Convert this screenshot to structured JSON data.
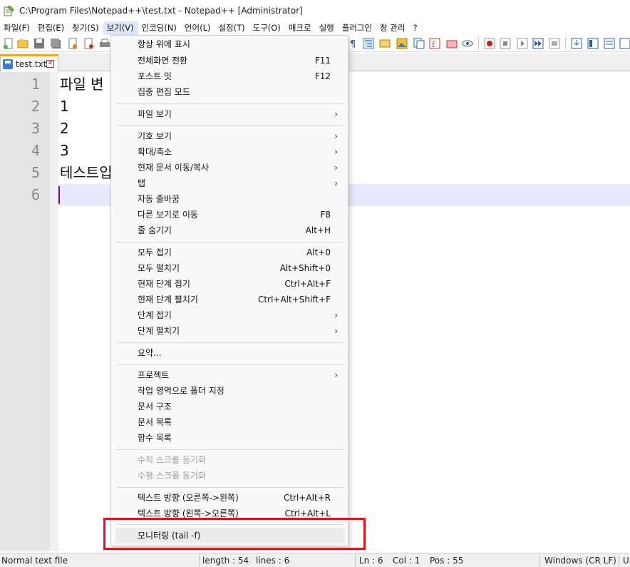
{
  "window": {
    "title": "C:\\Program Files\\Notepad++\\test.txt - Notepad++ [Administrator]"
  },
  "menubar": {
    "items": [
      {
        "label": "파일(F)"
      },
      {
        "label": "편집(E)"
      },
      {
        "label": "찾기(S)"
      },
      {
        "label": "보기(V)"
      },
      {
        "label": "인코딩(N)"
      },
      {
        "label": "언어(L)"
      },
      {
        "label": "설정(T)"
      },
      {
        "label": "도구(O)"
      },
      {
        "label": "매크로"
      },
      {
        "label": "실행"
      },
      {
        "label": "플러그인"
      },
      {
        "label": "창 관리"
      },
      {
        "label": "?"
      }
    ]
  },
  "tab": {
    "label": "test.txt",
    "close_glyph": "✕"
  },
  "editor": {
    "lines": [
      {
        "number": "1",
        "text": "파일  변"
      },
      {
        "number": "2",
        "text": "1"
      },
      {
        "number": "3",
        "text": "2"
      },
      {
        "number": "4",
        "text": "3"
      },
      {
        "number": "5",
        "text": "테스트입"
      },
      {
        "number": "6",
        "text": ""
      }
    ]
  },
  "view_menu": {
    "items": [
      {
        "label": "항상 위에 표시",
        "shortcut": ""
      },
      {
        "label": "전체화면 전환",
        "shortcut": "F11"
      },
      {
        "label": "포스트 잇",
        "shortcut": "F12"
      },
      {
        "label": "집중 편집 모드",
        "shortcut": ""
      },
      {
        "label": "파일 보기",
        "shortcut": ""
      },
      {
        "label": "기호 보기",
        "shortcut": ""
      },
      {
        "label": "확대/축소",
        "shortcut": ""
      },
      {
        "label": "현재 문서 이동/복사",
        "shortcut": ""
      },
      {
        "label": "탭",
        "shortcut": ""
      },
      {
        "label": "자동 줄바꿈",
        "shortcut": ""
      },
      {
        "label": "다른 보기로 이동",
        "shortcut": "F8"
      },
      {
        "label": "줄 숨기기",
        "shortcut": "Alt+H"
      },
      {
        "label": "모두 접기",
        "shortcut": "Alt+0"
      },
      {
        "label": "모두 펼치기",
        "shortcut": "Alt+Shift+0"
      },
      {
        "label": "현재 단계 접기",
        "shortcut": "Ctrl+Alt+F"
      },
      {
        "label": "현재 단계 펼치기",
        "shortcut": "Ctrl+Alt+Shift+F"
      },
      {
        "label": "단계 접기",
        "shortcut": ""
      },
      {
        "label": "단계 펼치기",
        "shortcut": ""
      },
      {
        "label": "요약...",
        "shortcut": ""
      },
      {
        "label": "프로젝트",
        "shortcut": ""
      },
      {
        "label": "작업 영역으로 폴더 지정",
        "shortcut": ""
      },
      {
        "label": "문서 구조",
        "shortcut": ""
      },
      {
        "label": "문서 목록",
        "shortcut": ""
      },
      {
        "label": "함수 목록",
        "shortcut": ""
      },
      {
        "label": "수직 스크롤 동기화",
        "shortcut": ""
      },
      {
        "label": "수평 스크롤 동기화",
        "shortcut": ""
      },
      {
        "label": "텍스트 방향 (오른쪽->왼쪽)",
        "shortcut": "Ctrl+Alt+R"
      },
      {
        "label": "텍스트 방향 (왼쪽->오른쪽)",
        "shortcut": "Ctrl+Alt+L"
      },
      {
        "label": "모니터링 (tail -f)",
        "shortcut": ""
      }
    ],
    "submenu_arrow": "›"
  },
  "statusbar": {
    "file_type": "Normal text file",
    "length": "length : 54",
    "lines": "lines : 6",
    "ln": "Ln : 6",
    "col": "Col : 1",
    "pos": "Pos : 55",
    "eol": "Windows (CR LF)",
    "encoding": "U"
  },
  "colors": {
    "annotation_box": "#e0141e",
    "current_line": "#e8e8ff",
    "caret": "#8000c0",
    "tab_accent": "#f5a623"
  }
}
